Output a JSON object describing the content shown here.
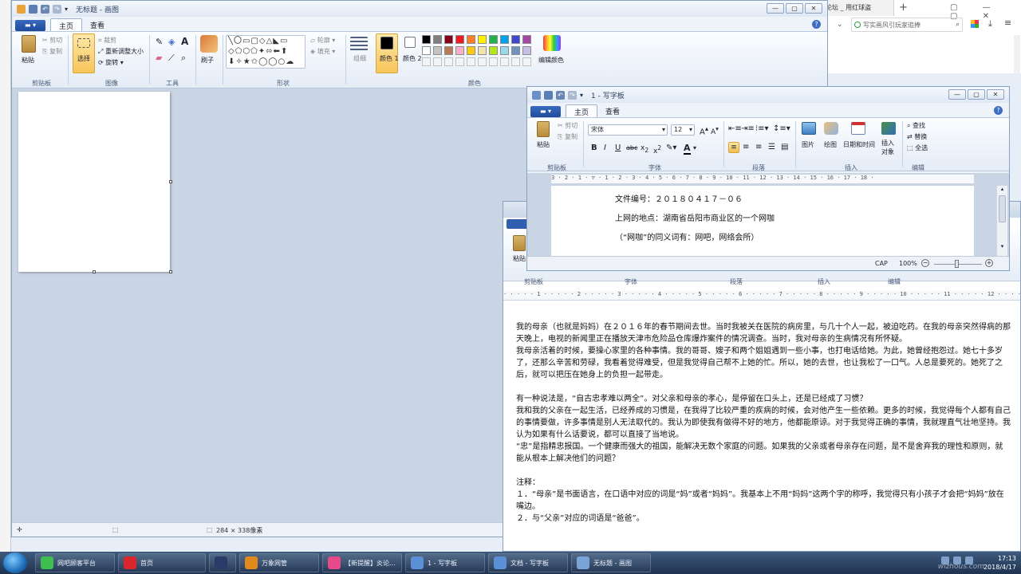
{
  "browser": {
    "tab_title": "论坛 _ 用红球盗",
    "new_tab": "+",
    "search_placeholder": "写实画风引玩家追捧",
    "menu_icon": "hamburger-icon"
  },
  "paint": {
    "title": "无标题 - 画图",
    "tabs": [
      "主页",
      "查看"
    ],
    "clipboard": {
      "paste": "粘贴",
      "cut": "剪切",
      "copy": "复制",
      "label": "剪贴板"
    },
    "image": {
      "select": "选择",
      "crop": "裁剪",
      "resize": "重新调整大小",
      "rotate": "旋转",
      "label": "图像"
    },
    "tools": {
      "label": "工具"
    },
    "brushes": {
      "label": "刷子"
    },
    "shapes": {
      "outline": "轮廓",
      "fill": "填充",
      "label": "形状"
    },
    "size": {
      "label": "组细"
    },
    "colors": {
      "color1": "颜色 1",
      "color2": "颜色 2",
      "edit": "编辑颜色",
      "label": "颜色",
      "palette": [
        "#000000",
        "#7f7f7f",
        "#880015",
        "#ed1c24",
        "#ff7f27",
        "#fff200",
        "#22b14c",
        "#00a2e8",
        "#3f48cc",
        "#a349a4",
        "#ffffff",
        "#c3c3c3",
        "#b97a57",
        "#ffaec9",
        "#ffc90e",
        "#efe4b0",
        "#b5e61d",
        "#99d9ea",
        "#7092be",
        "#c8bfe7"
      ]
    },
    "status": {
      "size": "284 × 338像素"
    }
  },
  "wordpad_front": {
    "title": "1 - 写字板",
    "tabs": [
      "主页",
      "查看"
    ],
    "clipboard": {
      "paste": "粘贴",
      "cut": "剪切",
      "copy": "复制",
      "label": "剪贴板"
    },
    "font": {
      "name": "宋体",
      "size": "12",
      "label": "字体"
    },
    "paragraph": {
      "label": "段落"
    },
    "insert": {
      "picture": "图片",
      "paint": "绘图",
      "datetime": "日期和时间",
      "object": "插入\n对象",
      "label": "插入"
    },
    "edit": {
      "find": "查找",
      "replace": "替换",
      "select_all": "全选",
      "label": "编辑"
    },
    "ruler": "3 · 2 · 1 · ▽ · 1 · 2 · 3 · 4 · 5 · 6 · 7 · 8 · 9 · 10 · 11 · 12 · 13 · 14 · 15 · 16 · 17 · 18 ·",
    "doc_lines": [
      "文件编号：２０１８０４１７－０６",
      "上网的地点：湖南省岳阳市商业区的一个网咖",
      "（“网咖”的同义词有：网吧，网络会所）"
    ],
    "status": {
      "cap": "CAP",
      "zoom": "100%"
    }
  },
  "wordpad_back": {
    "labels": {
      "paste": "粘贴",
      "clipboard": "剪贴板",
      "font": "字体",
      "paragraph": "段落",
      "insert": "插入",
      "edit": "编辑"
    },
    "ruler": "· · · · · 1 · · · · · 2 · · · · · 3 · · · · · 4 · · · · · 5 · · · · · 6 · · · · · 7 · · · · · 8 · · · · · 9 · · · · · 10 · · · · · 11 · · · · · 12 · · · · · 13 · · · · · 14 · · · · · 15 · · · · · 16 · · · · · 17 · · · · · 18",
    "paragraphs": [
      "我的母亲（也就是妈妈）在２０１６年的春节期间去世。当时我被关在医院的病房里，与几十个人一起，被迫吃药。在我的母亲突然得病的那天晚上，电视的新闻里正在播放天津市危险品仓库爆炸案件的情况调查。当时，我对母亲的生病情况有所怀疑。",
      "我母亲活着的时候，要操心家里的各种事情。我的哥哥、嫂子和两个姐姐遇到一些小事，也打电话给她。为此，她曾经抱怨过。她七十多岁了，还那么辛苦和劳碌，我看着觉得难受，但是我觉得自己帮不上她的忙。所以，她的去世，也让我松了一口气。人总是要死的。她死了之后，就可以把压在她身上的负担一起带走。",
      "",
      "有一种说法是，“自古忠孝难以两全”。对父亲和母亲的孝心，是停留在口头上，还是已经成了习惯？",
      "我和我的父亲在一起生活，已经养成的习惯是，在我得了比较严重的疾病的时候，会对他产生一些依赖。更多的时候，我觉得每个人都有自己的事情要做，许多事情是别人无法取代的。我认为即使我有做得不好的地方，他都能原谅。对于我觉得正确的事情，我就理直气壮地坚持。我认为如果有什么话要说，都可以直接了当地说。",
      "“忠”是指精忠报国。一个健康而强大的祖国，能解决无数个家庭的问题。如果我的父亲或者母亲存在问题，是不是舍弃我的理性和原则，就能从根本上解决他们的问题？",
      "",
      "注释：",
      "１．“母亲”是书面语言，在口语中对应的词是“妈”或者“妈妈”。我基本上不用“妈妈”这两个字的称呼，我觉得只有小孩子才会把“妈妈”放在嘴边。",
      "２．与“父亲”对应的词语是“爸爸”。"
    ]
  },
  "taskbar": {
    "items": [
      {
        "label": "网吧顾客平台",
        "color": "#3fbf4f"
      },
      {
        "label": "首页",
        "color": "#d8262c"
      },
      {
        "label": "",
        "color": "#2a3b6a"
      },
      {
        "label": "万象网管",
        "color": "#e08a1e"
      },
      {
        "label": "【新提醒】炎论...",
        "color": "#e64a8a"
      },
      {
        "label": "1 - 写字板",
        "color": "#5b8fd6"
      },
      {
        "label": "文档 - 写字板",
        "color": "#5b8fd6"
      },
      {
        "label": "无标题 - 画图",
        "color": "#7aa4d8"
      }
    ],
    "clock_time": "17:13",
    "clock_date": "2018/4/17",
    "watermark": "wizhous.com"
  }
}
